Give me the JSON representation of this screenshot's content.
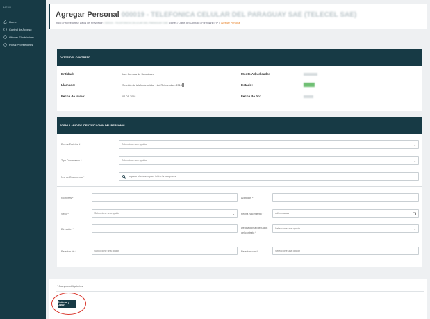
{
  "sidebar": {
    "menu_label": "MENÚ",
    "items": [
      {
        "label": "Home",
        "icon": "home-icon"
      },
      {
        "label": "Control de Acceso",
        "icon": "circle-icon"
      },
      {
        "label": "Ofertas Electrónicas",
        "icon": "circle-icon"
      },
      {
        "label": "Portal Proveedores",
        "icon": "circle-icon"
      }
    ]
  },
  "header": {
    "title": "Agregar Personal",
    "blurred_title": "000019 - TELEFONICA CELULAR DEL PARAGUAY SAE (TELECEL SAE)",
    "crumb_start": "Inicio / Proveedores / Datos del Proveedor:",
    "crumb_blur": "000019 - TELEFONICA CELULAR DEL PARAGUAY SAE",
    "crumb_end": "ciones / Datos del Contrato / Formulario FIP /",
    "crumb_active": "Agregar Personal"
  },
  "contract": {
    "title": "DATOS DEL CONTRATO",
    "entidad_label": "Entidad:",
    "entidad_value": "Ucc Camara de Senadores",
    "llamado_label": "Llamado:",
    "llamado_value": "Servicio de telefonía celular - Ad Referendum 2018",
    "fecha_inicio_label": "Fecha de inicio:",
    "fecha_inicio_value": "02-01-2018",
    "monto_label": "Monto Adjudicado:",
    "estado_label": "Estado:",
    "fecha_fin_label": "Fecha de fin:"
  },
  "form": {
    "title": "FORMULARIO DE IDENTIFICACIÓN DEL PERSONAL",
    "select_placeholder": "Seleccione una opción",
    "rol_label": "Rol de Emisión *",
    "tipo_doc_label": "Tipo Documento *",
    "nro_doc_label": "Nro de Documento *",
    "nro_doc_placeholder": "Ingrese el número para iniciar la búsqueda",
    "nombres_label": "Nombres *",
    "apellidos_label": "Apellidos *",
    "sexo_label": "Sexo *",
    "fecha_nac_label": "Fecha Nacimiento *",
    "fecha_nac_placeholder": "dd/mm/aaaa",
    "direccion_label": "Dirección *",
    "dedicacion_label_1": "Dedicación a Ejecución",
    "dedicacion_label_2": "del contrato *",
    "relacion_de_label": "Relación de *",
    "relacion_con_label": "Relación con *"
  },
  "footer": {
    "required_note": "* Campos obligatorios",
    "submit_label": "Ordenar y Listar",
    "annotation_color": "#d9352b"
  },
  "colors": {
    "primary": "#173a45",
    "accent": "#e67e22"
  }
}
